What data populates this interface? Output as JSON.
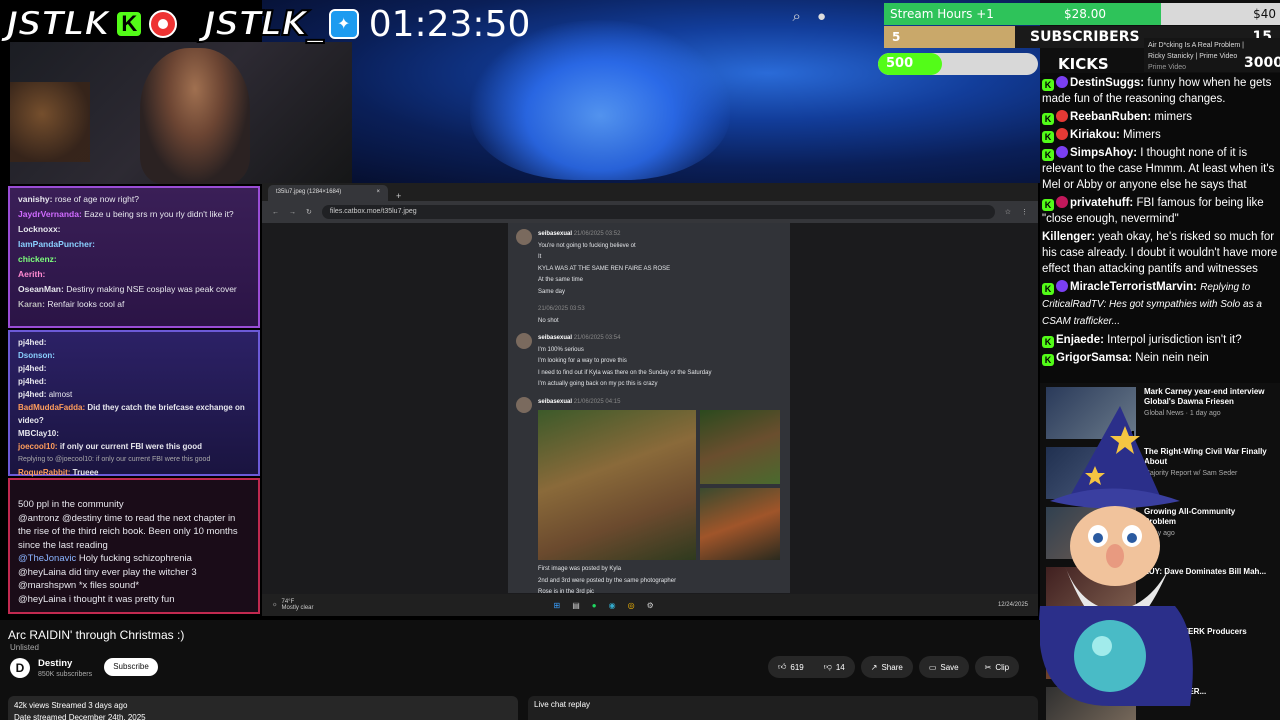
{
  "overlay": {
    "logo1": "JSTLK",
    "logo1_k": "K",
    "logo2": "JSTLK_",
    "timer": "01:23:50"
  },
  "goals": {
    "stream_hours": "Stream Hours +1",
    "amount": "$28.00",
    "amount_goal": "$40",
    "amount_progress": 0.7,
    "subs_current": "5",
    "subs_label": "SUBSCRIBERS",
    "subs_goal": "15",
    "subs_progress": 0.33,
    "kicks_current": "500",
    "kicks_label": "KICKS",
    "kicks_goal": "3000",
    "kicks_progress": 0.17
  },
  "recommended_mini": {
    "title": "Air D*cking Is A Real Problem |",
    "sub": "Ricky Stanicky | Prime Video",
    "channel": "Prime Video"
  },
  "stream_chat": {
    "panel1": [
      {
        "name": "vanishy:",
        "text": "rose of age now right?"
      },
      {
        "name": "JaydrVernanda:",
        "text": "Eaze u being srs rn you rly didn't like it?"
      },
      {
        "name": "Locknoxx:",
        "text": ""
      },
      {
        "name": "IamPandaPuncher:",
        "text": ""
      },
      {
        "name": "chickenz:",
        "text": ""
      },
      {
        "name": "Aerith:",
        "text": ""
      },
      {
        "name": "OseanMan:",
        "text": "Destiny making NSE cosplay was peak cover"
      },
      {
        "name": "Karan:",
        "text": "Renfair looks cool af"
      }
    ],
    "panel2": [
      {
        "name": "pj4hed:",
        "text": ""
      },
      {
        "name": "Dsonson:",
        "text": ""
      },
      {
        "name": "pj4hed:",
        "text": ""
      },
      {
        "name": "pj4hed:",
        "text": ""
      },
      {
        "name": "pj4hed:",
        "text": "almost"
      },
      {
        "name": "BadMuddaFadda:",
        "text": "Did they catch the briefcase exchange on video?"
      },
      {
        "name": "MBClay10:",
        "text": ""
      },
      {
        "name": "joecool10:",
        "text": "if only our current FBI were this good"
      },
      {
        "name": "Replying to @joecool10:",
        "text": "if only our current FBI were this good"
      },
      {
        "name": "RoqueRabbit:",
        "text": "Trueee"
      }
    ],
    "panel3": [
      {
        "name": "",
        "text": "500 ppl in the community"
      },
      {
        "name": "@antronz",
        "text": "@destiny time to read the next chapter in the rise of the third reich book. Been only 10 months since the last reading"
      },
      {
        "name": "@TheJonavic",
        "text": "Holy fucking schizophrenia"
      },
      {
        "name": "@heyLaina",
        "text": "did tiny ever play the witcher 3"
      },
      {
        "name": "@marshspwn",
        "text": "*x files sound*"
      },
      {
        "name": "@heyLaina",
        "text": "i thought it was pretty fun"
      }
    ]
  },
  "browser": {
    "tab_title": "t35lu7.jpeg (1284×1684)",
    "url": "files.catbox.moe/t35lu7.jpeg",
    "messages": [
      {
        "user": "seibasexual",
        "time": "21/06/2025 03:52",
        "lines": [
          "You're not going to fucking believe ot",
          "It",
          "KYLA WAS AT THE SAME REN FAIRE AS ROSE",
          "At the same time",
          "Same day"
        ]
      },
      {
        "user": "",
        "time": "21/06/2025 03:53",
        "lines": [
          "No shot"
        ]
      },
      {
        "user": "seibasexual",
        "time": "21/06/2025 03:54",
        "lines": [
          "I'm 100% serious",
          "I'm looking for a way to prove this",
          "I need to find out if Kyla was there on the Sunday or the Saturday",
          "I'm actually going back on my pc this is crazy"
        ]
      },
      {
        "user": "seibasexual",
        "time": "21/06/2025 04:15",
        "lines": [
          "First image was posted by Kyla",
          "2nd and 3rd were posted by the same photographer",
          "Rose is in the 3rd pic"
        ]
      }
    ],
    "weather_temp": "74°F",
    "weather_desc": "Mostly clear",
    "date": "12/24/2025"
  },
  "video": {
    "title": "Arc RAIDIN' through Christmas :)",
    "visibility": "Unlisted",
    "channel": "Destiny",
    "subscribers": "850K subscribers",
    "subscribe_label": "Subscribe",
    "likes": "619",
    "dislikes": "14",
    "share": "Share",
    "save": "Save",
    "clip": "Clip",
    "views_line": "42k views  Streamed 3 days ago",
    "date_line": "Date streamed December 24th, 2025",
    "live_chat_replay": "Live chat replay"
  },
  "kick_chat": [
    {
      "user": "DestinSuggs:",
      "msg": "funny how when he gets made fun of the reasoning changes."
    },
    {
      "user": "ReebanRuben:",
      "msg": "mimers"
    },
    {
      "user": "Kiriakou:",
      "msg": "Mimers"
    },
    {
      "user": "SimpsAhoy:",
      "msg": "I thought none of it is relevant to the case  Hmmm. At least when it's Mel or Abby or anyone else he says that"
    },
    {
      "user": "privatehuff:",
      "msg": "FBI famous for being like \"close enough, nevermind\""
    },
    {
      "user": "Killenger:",
      "msg": "yeah okay, he's risked so much for his case already. I doubt it wouldn't have more effect than attacking pantifs and witnesses"
    },
    {
      "user": "MiracleTerroristMarvin:",
      "msg": "Replying to CriticalRadTV: Hes got sympathies with Solo as a CSAM trafficker..."
    },
    {
      "user": "Enjaede:",
      "msg": "Interpol jurisdiction isn't it?"
    },
    {
      "user": "GrigorSamsa:",
      "msg": "Nein nein nein"
    }
  ],
  "suggestions": [
    {
      "title": "Mark Carney year-end interview Global's Dawna Friesen",
      "meta": "Global News · 1 day ago",
      "duration": "2:03"
    },
    {
      "title": "The Right-Wing Civil War Finally About",
      "meta": "Majority Report w/ Sam Seder",
      "duration": ""
    },
    {
      "title": "Growing All-Community Problem",
      "meta": "1 day ago",
      "duration": ""
    },
    {
      "title": "LUY: Dave Dominates Bill Mah...",
      "meta": "",
      "duration": ""
    },
    {
      "title": "Goes BERZERK Producers",
      "meta": "ago",
      "duration": ""
    },
    {
      "title": "IT IS SO OVER...",
      "meta": "",
      "duration": ""
    }
  ]
}
